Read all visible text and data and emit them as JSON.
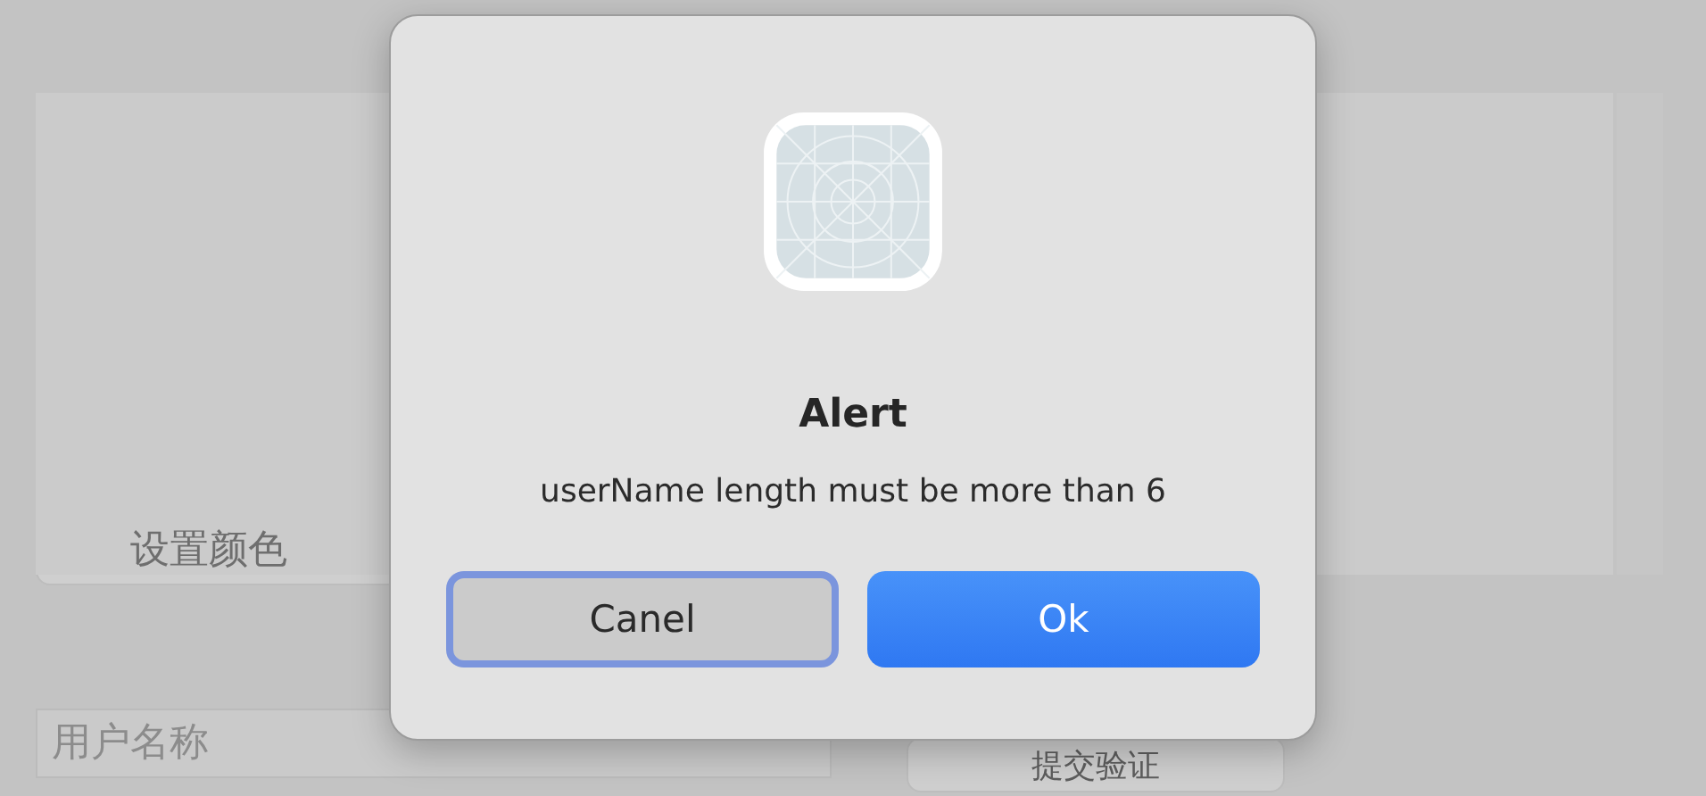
{
  "background": {
    "color_button": {
      "label": "设置颜色"
    },
    "username_field": {
      "placeholder": "用户名称"
    },
    "submit_button": {
      "label": "提交验证"
    }
  },
  "alert": {
    "title": "Alert",
    "message": "userName length must be more than 6",
    "buttons": [
      {
        "label": "Canel",
        "kind": "cancel",
        "focused": true
      },
      {
        "label": "Ok",
        "kind": "default",
        "focused": false
      }
    ]
  }
}
